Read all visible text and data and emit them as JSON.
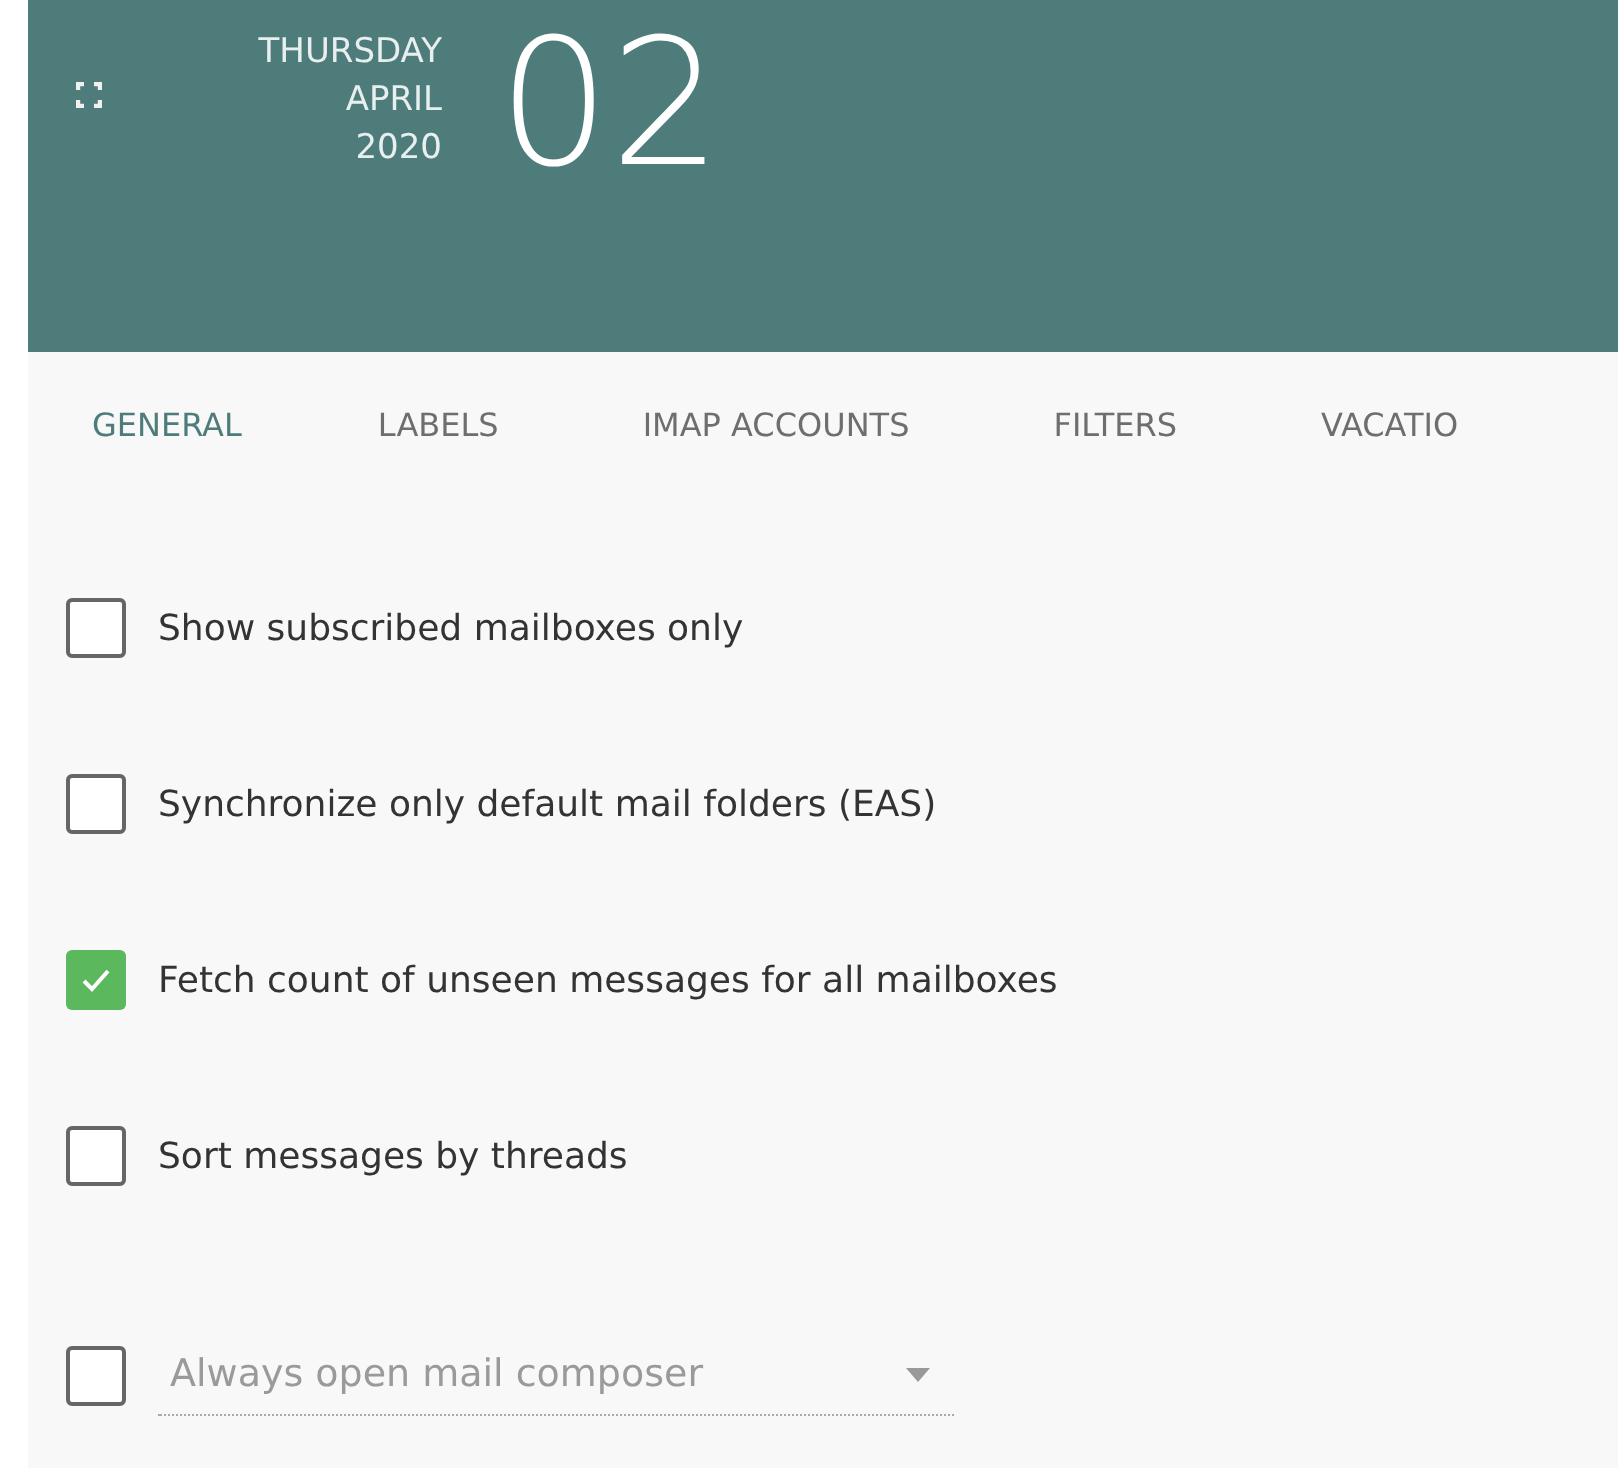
{
  "header": {
    "weekday": "THURSDAY",
    "month": "APRIL",
    "year": "2020",
    "day": "02"
  },
  "tabs": [
    {
      "label": "GENERAL",
      "selected": true
    },
    {
      "label": "LABELS",
      "selected": false
    },
    {
      "label": "IMAP ACCOUNTS",
      "selected": false
    },
    {
      "label": "FILTERS",
      "selected": false
    },
    {
      "label": "VACATIO",
      "selected": false
    }
  ],
  "options": [
    {
      "kind": "checkbox",
      "label": "Show subscribed mailboxes only",
      "checked": false
    },
    {
      "kind": "checkbox",
      "label": "Synchronize only default mail folders (EAS)",
      "checked": false
    },
    {
      "kind": "checkbox",
      "label": "Fetch count of unseen messages for all mailboxes",
      "checked": true
    },
    {
      "kind": "checkbox",
      "label": "Sort messages by threads",
      "checked": false
    },
    {
      "kind": "select",
      "value": "Always open mail composer",
      "checked": false
    }
  ]
}
